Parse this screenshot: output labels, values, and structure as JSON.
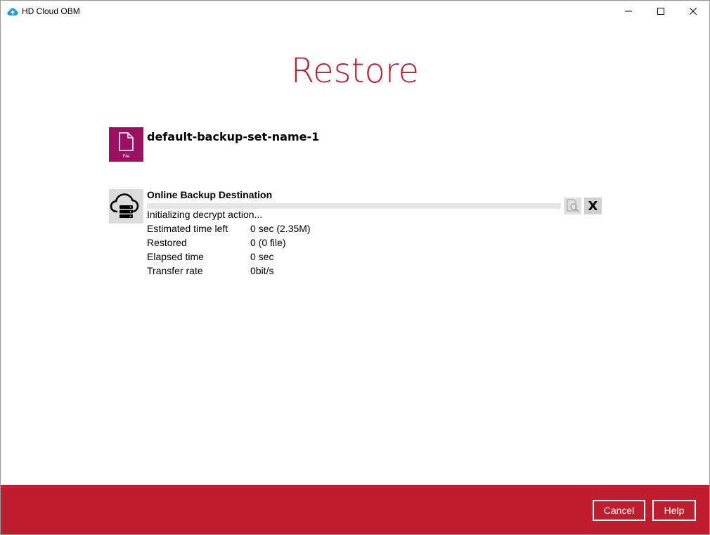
{
  "window": {
    "title": "HD Cloud OBM",
    "accent_color": "#be1e2d"
  },
  "page": {
    "title": "Restore"
  },
  "backup_set": {
    "name": "default-backup-set-name-1",
    "icon_name": "file-icon",
    "icon_label": "File",
    "icon_color": "#9c1063"
  },
  "destination": {
    "name": "Online Backup Destination",
    "icon_name": "cloud-server-icon",
    "status": "Initializing decrypt action...",
    "progress_fraction": 0,
    "details": [
      {
        "label": "Estimated time left",
        "value": "0 sec (2.35M)"
      },
      {
        "label": "Restored",
        "value": "0 (0 file)"
      },
      {
        "label": "Elapsed time",
        "value": "0 sec"
      },
      {
        "label": "Transfer rate",
        "value": "0bit/s"
      }
    ],
    "stop_label": "X"
  },
  "footer": {
    "cancel_label": "Cancel",
    "help_label": "Help"
  }
}
